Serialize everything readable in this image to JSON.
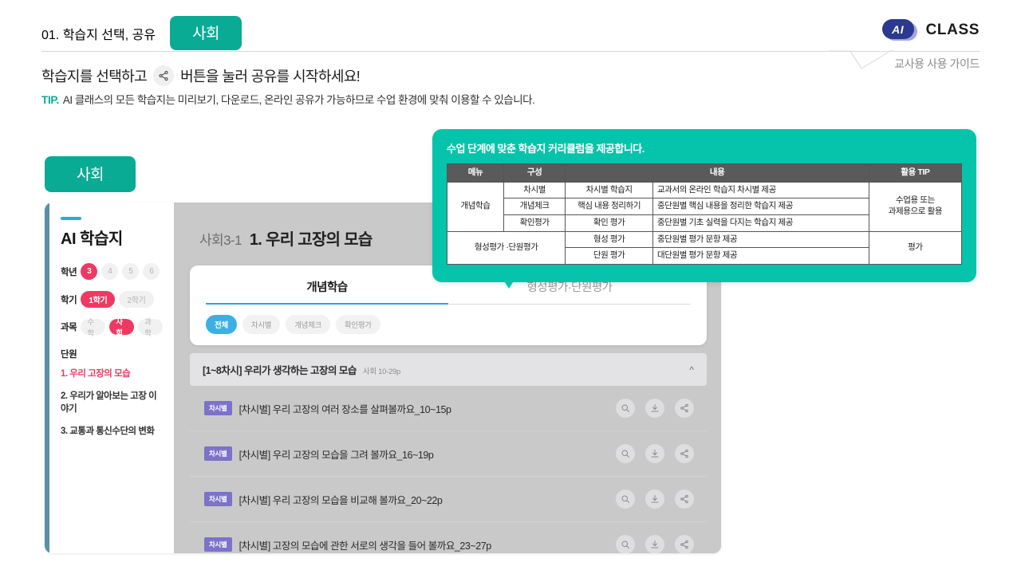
{
  "header": {
    "title": "01. 학습지 선택, 공유",
    "subject_chip": "사회",
    "brand_badge": "AI",
    "brand_text": "CLASS",
    "guide": "교사용 사용 가이드"
  },
  "intro": {
    "lead_before": "학습지를 선택하고",
    "share_icon": "share-icon",
    "lead_after": "버튼을 눌러 공유를 시작하세요!",
    "tip_key": "TIP.",
    "tip_body": "AI 클래스의 모든 학습지는 미리보기, 다운로드, 온라인 공유가 가능하므로 수업 환경에 맞춰 이용할 수 있습니다."
  },
  "subject_tab": "사회",
  "callout": {
    "heading": "수업 단계에 맞춘 학습지 커리큘럼을 제공합니다.",
    "columns": [
      "메뉴",
      "구성",
      "내용",
      "활용 TIP"
    ],
    "rows": [
      {
        "menu": "개념학습",
        "config": "차시별",
        "name": "차시별 학습지",
        "desc": "교과서의 온라인 학습지 차시별 제공",
        "tip": "수업용 또는\n과제용으로 활용"
      },
      {
        "menu": "",
        "config": "개념체크",
        "name": "핵심 내용 정리하기",
        "desc": "중단원별 핵심 내용을 정리한 학습지 제공",
        "tip": ""
      },
      {
        "menu": "",
        "config": "확인평가",
        "name": "확인 평가",
        "desc": "중단원별 기초 실력을 다지는 학습지 제공",
        "tip": ""
      },
      {
        "menu": "형성평가 ·단원평가",
        "config": "",
        "name": "형성 평가",
        "desc": "중단원별 평가 문항 제공",
        "tip": "평가"
      },
      {
        "menu": "",
        "config": "",
        "name": "단원 평가",
        "desc": "대단원별 평가 문항 제공",
        "tip": ""
      }
    ],
    "tip_concept": "수업용 또는\n과제용으로 활용",
    "tip_eval": "평가"
  },
  "mock": {
    "sidebar": {
      "logo": "AI 학습지",
      "grade_label": "학년",
      "grades": [
        {
          "label": "3",
          "selected": true
        },
        {
          "label": "4",
          "selected": false
        },
        {
          "label": "5",
          "selected": false
        },
        {
          "label": "6",
          "selected": false
        }
      ],
      "term_label": "학기",
      "terms": [
        {
          "label": "1학기",
          "selected": true
        },
        {
          "label": "2학기",
          "selected": false
        }
      ],
      "subject_label": "과목",
      "subjects": [
        {
          "label": "수학",
          "selected": false
        },
        {
          "label": "사회",
          "selected": true
        },
        {
          "label": "과학",
          "selected": false
        }
      ],
      "unit_label": "단원",
      "units": [
        {
          "label": "1. 우리 고장의 모습",
          "selected": true
        },
        {
          "label": "2. 우리가 알아보는 고장 이야기",
          "selected": false
        },
        {
          "label": "3. 교통과 통신수단의 변화",
          "selected": false
        }
      ]
    },
    "content": {
      "code": "사회3-1",
      "title": "1. 우리 고장의 모습",
      "tabs": [
        {
          "label": "개념학습",
          "active": true
        },
        {
          "label": "형성평가·단원평가",
          "active": false
        }
      ],
      "chips": [
        {
          "label": "전체",
          "active": true
        },
        {
          "label": "차시별",
          "active": false
        },
        {
          "label": "개념체크",
          "active": false
        },
        {
          "label": "확인평가",
          "active": false
        }
      ],
      "accordion": {
        "title": "[1~8차시] 우리가 생각하는 고장의 모습",
        "meta": "사회 10-29p",
        "caret": "chevron-up-icon"
      },
      "rows": [
        {
          "tag": "차시별",
          "title": "[차시별] 우리 고장의 여러 장소를 살펴볼까요_10~15p"
        },
        {
          "tag": "차시별",
          "title": "[차시별] 우리 고장의 모습을 그려 볼까요_16~19p"
        },
        {
          "tag": "차시별",
          "title": "[차시별] 우리 고장의 모습을 비교해 볼까요_20~22p"
        },
        {
          "tag": "차시별",
          "title": "[차시별] 고장의 모습에 관한 서로의 생각을 들어 볼까요_23~27p"
        }
      ],
      "actions": [
        "preview-icon",
        "download-icon",
        "share-icon"
      ]
    }
  },
  "colors": {
    "teal": "#06c4ab",
    "teal_dark": "#0aab95",
    "pink": "#ee3a63",
    "blue": "#2aa8e0",
    "purple": "#7b72c9",
    "navy": "#2b3990"
  }
}
